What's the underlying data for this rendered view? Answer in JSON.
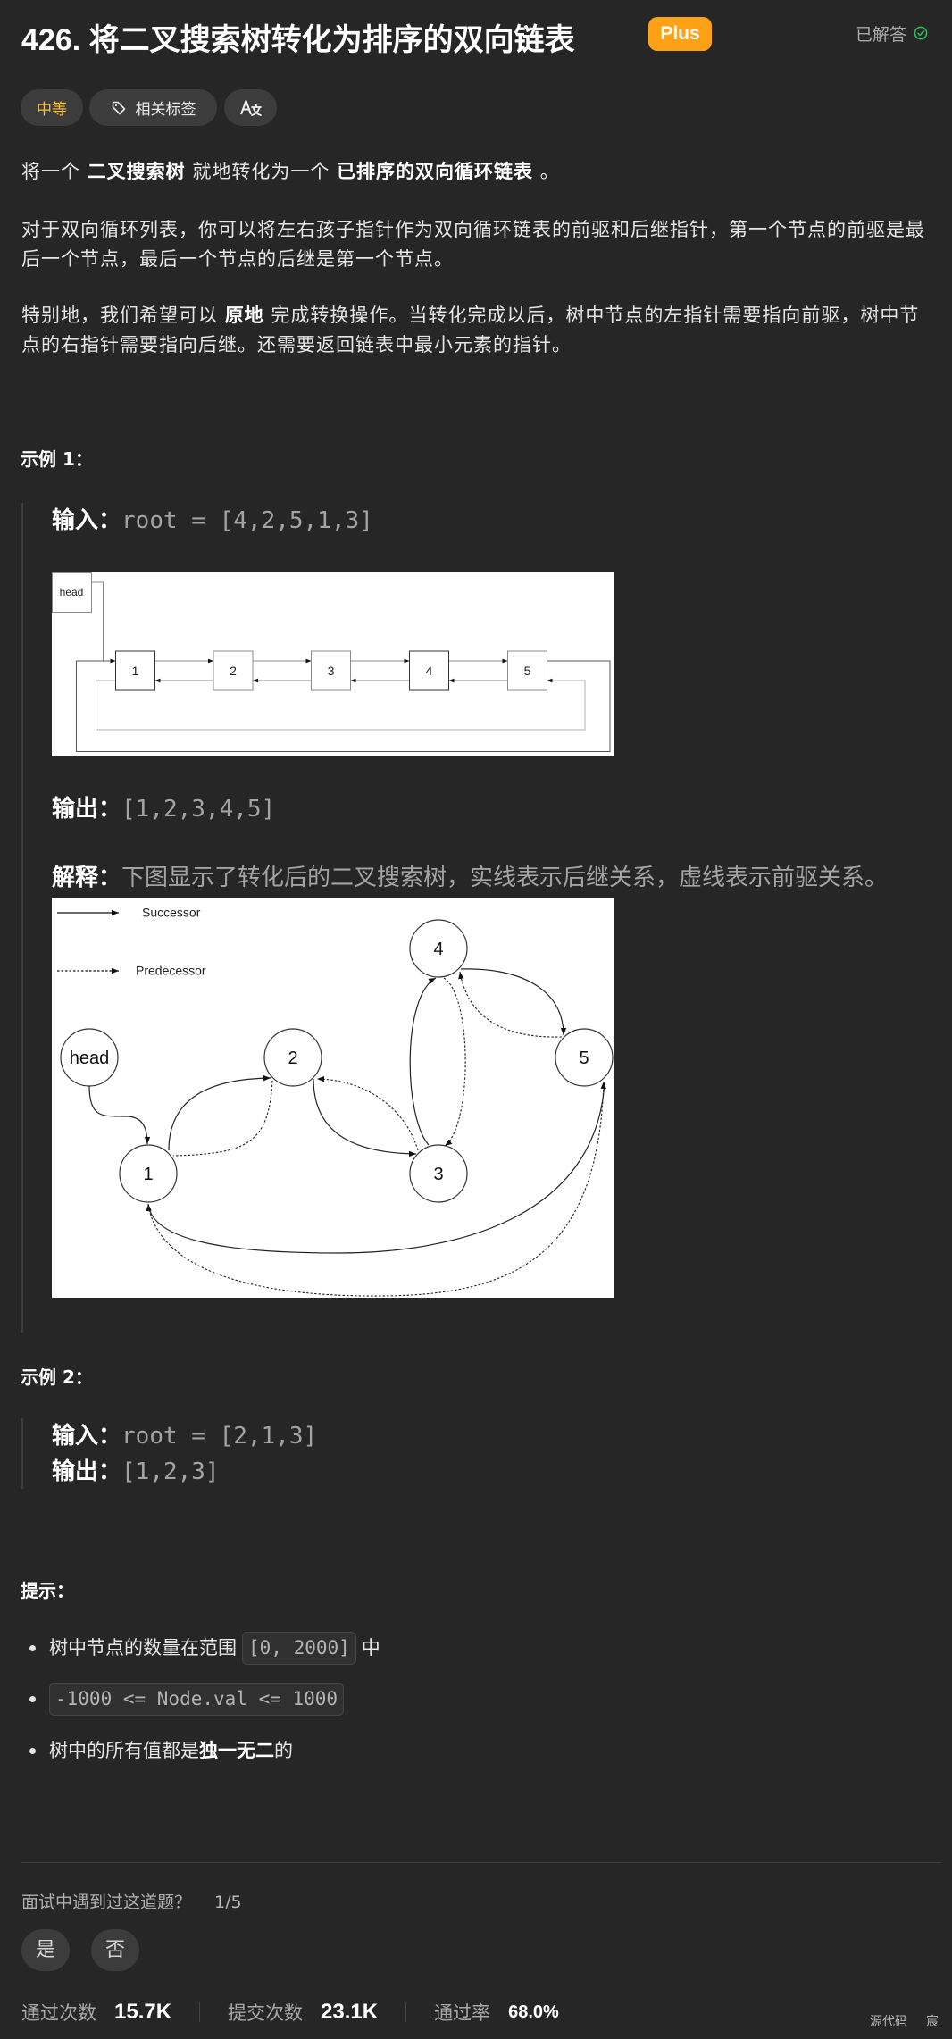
{
  "colors": {
    "background": "#262626",
    "plus_badge": "#ffa116",
    "difficulty_medium": "#ffc01e",
    "solved_green": "#2cbb5d"
  },
  "header": {
    "number": "426. ",
    "title": "将二叉搜索树转化为排序的双向链表",
    "plus_badge": "Plus",
    "status": "已解答",
    "status_icon": "check-circle-icon"
  },
  "tags": {
    "difficulty": "中等",
    "related_tags": "相关标签",
    "related_tags_icon": "tag-icon",
    "translate_icon": "translate-icon"
  },
  "description": {
    "p1": [
      "将一个 ",
      "二叉搜索树",
      " 就地转化为一个 ",
      "已排序的双向循环链表",
      " 。"
    ],
    "p2": [
      "对于双向循环列表，你可以将左右孩子指针作为双向循环链表的前驱和后继指针，第一个节点的前驱是最后一个节点，最后一个节点的后继是第一个节点。"
    ],
    "p3": [
      "特别地，我们希望可以 ",
      "原地",
      " 完成转换操作。当转化完成以后，树中节点的左指针需要指向前驱，树中节点的右指针需要指向后继。还需要返回链表中最小元素的指针。"
    ]
  },
  "examples": [
    {
      "heading": "示例 1：",
      "input_label": "输入：",
      "input_value": "root = [4,2,5,1,3]",
      "output_label": "输出：",
      "output_value": "[1,2,3,4,5]",
      "explanation_label": "解释：",
      "explanation": "下图显示了转化后的二叉搜索树，实线表示后继关系，虚线表示前驱关系。"
    },
    {
      "heading": "示例 2：",
      "input_label": "输入：",
      "input_value": "root = [2,1,3]",
      "output_label": "输出：",
      "output_value": "[1,2,3]"
    }
  ],
  "figures": {
    "linked_list": {
      "head_label": "head",
      "nodes": [
        "1",
        "2",
        "3",
        "4",
        "5"
      ]
    },
    "tree": {
      "legend": {
        "successor": "Successor",
        "predecessor": "Predecessor"
      },
      "head_label": "head",
      "nodes": [
        "1",
        "2",
        "3",
        "4",
        "5"
      ]
    }
  },
  "hints": {
    "heading": "提示：",
    "items": [
      {
        "before": "树中节点的数量在范围",
        "code": "[0, 2000]",
        "after": "中"
      },
      {
        "code": "-1000 <= Node.val <= 1000"
      },
      {
        "before": "树中的所有值都是 ",
        "bold": "独一无二",
        "after": " 的"
      }
    ]
  },
  "interview": {
    "question": "面试中遇到过这道题？",
    "count": "1/5",
    "yes": "是",
    "no": "否"
  },
  "stats": {
    "accepted_label": "通过次数",
    "accepted": "15.7K",
    "submissions_label": "提交次数",
    "submissions": "23.1K",
    "rate_label": "通过率",
    "rate": "68.0%"
  },
  "footer": {
    "source_code": "源代码",
    "extra": "宸"
  }
}
